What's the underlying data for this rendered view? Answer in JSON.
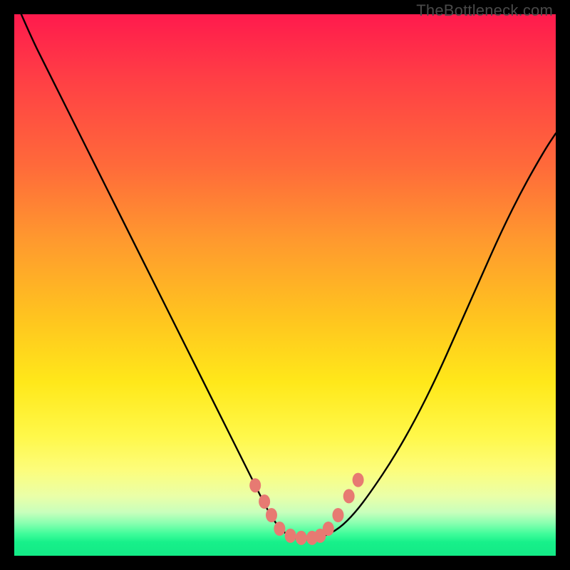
{
  "watermark": "TheBottleneck.com",
  "chart_data": {
    "type": "line",
    "title": "",
    "xlabel": "",
    "ylabel": "",
    "xlim": [
      0,
      100
    ],
    "ylim": [
      0,
      100
    ],
    "x": [
      0,
      3,
      6,
      9,
      12,
      15,
      18,
      21,
      24,
      27,
      30,
      33,
      36,
      39,
      42,
      45,
      47,
      49,
      51,
      53,
      55,
      57,
      60,
      63,
      66,
      70,
      74,
      78,
      82,
      86,
      90,
      94,
      98,
      100
    ],
    "y": [
      103,
      96,
      90,
      84,
      78,
      72,
      66,
      60,
      54,
      48,
      42,
      36,
      30,
      24,
      18,
      12,
      8,
      5,
      3.5,
      3,
      3,
      3.5,
      5,
      8,
      12,
      18,
      25,
      33,
      42,
      51,
      60,
      68,
      75,
      78
    ],
    "markers": {
      "x": [
        44.5,
        46.2,
        47.5,
        49,
        51,
        53,
        55,
        56.5,
        58,
        59.8,
        61.8,
        63.5
      ],
      "y": [
        13,
        10,
        7.5,
        5,
        3.7,
        3.3,
        3.3,
        3.7,
        5,
        7.5,
        11,
        14
      ],
      "color": "#e77a72"
    },
    "curve_color": "#000000",
    "curve_width": 2.4
  }
}
